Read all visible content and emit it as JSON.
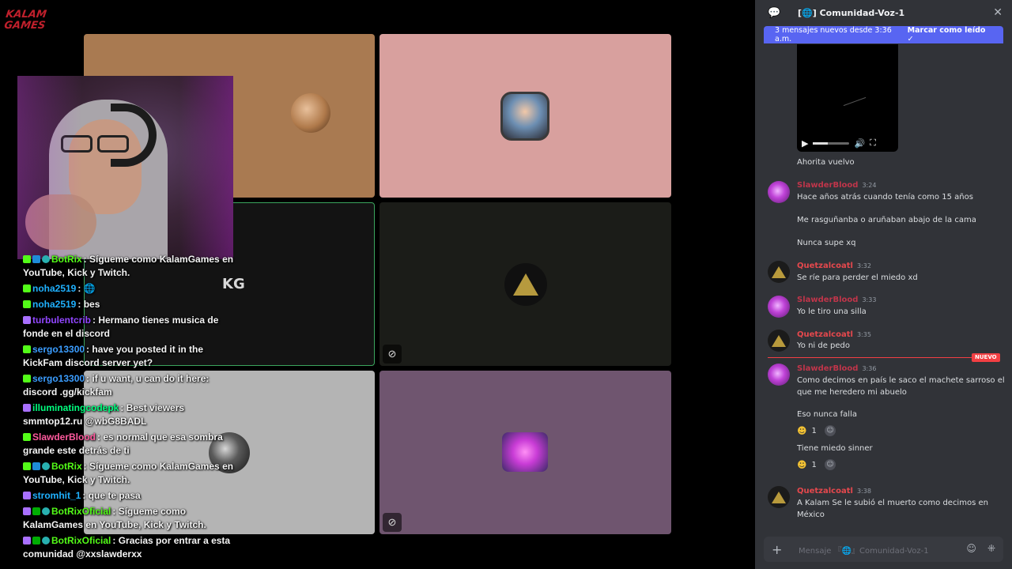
{
  "stream": {
    "logo": {
      "line1": "KALAM",
      "line2": "GAMES"
    },
    "overlay_logo": "KG",
    "colors": {
      "tile_brown": "#a97a51",
      "tile_pink": "#d8a09e",
      "tile_dark": "#131313",
      "tile_gray": "#b4b4b4",
      "tile_purple": "#6f556f",
      "speaking_border": "#3ba55d"
    }
  },
  "chat": [
    {
      "badges": [
        "kick",
        "vip",
        "ok"
      ],
      "user": "BotRix",
      "color": "#53fc18",
      "text": ": Sígueme como KalamGames en YouTube, Kick y Twitch."
    },
    {
      "badges": [
        "kick"
      ],
      "user": "noha2519",
      "color": "#1fb1ff",
      "text": ": 🌐"
    },
    {
      "badges": [
        "kick"
      ],
      "user": "noha2519",
      "color": "#1fb1ff",
      "text": ": bes"
    },
    {
      "badges": [
        "twitch"
      ],
      "user": "turbulentcrib",
      "color": "#9146ff",
      "text": ": Hermano tienes musica de fonde en el discord"
    },
    {
      "badges": [
        "kick"
      ],
      "user": "sergo13300",
      "color": "#3b9dff",
      "text": ": have you posted it in the KickFam discord server yet?"
    },
    {
      "badges": [
        "kick"
      ],
      "user": "sergo13300",
      "color": "#3b9dff",
      "text": ": if u want, u can do it here: discord .gg/kickfam"
    },
    {
      "badges": [
        "twitch"
      ],
      "user": "illuminatingcodepk",
      "color": "#00ff7f",
      "text": ": Best viewers smmtop12.ru @wbG8BADL"
    },
    {
      "badges": [
        "kick"
      ],
      "user": "SlawderBlood",
      "color": "#ff5a9e",
      "text": ": es normal que esa sombra grande este detrás de ti"
    },
    {
      "badges": [
        "kick",
        "vip",
        "ok"
      ],
      "user": "BotRix",
      "color": "#53fc18",
      "text": ": Sígueme como KalamGames en YouTube, Kick y Twitch."
    },
    {
      "badges": [
        "twitch"
      ],
      "user": "stromhit_1",
      "color": "#1fb1ff",
      "text": ": que te pasa"
    },
    {
      "badges": [
        "twitch",
        "mod",
        "ok"
      ],
      "user": "BotRixOficial",
      "color": "#53fc18",
      "text": ": Sígueme como KalamGames en YouTube, Kick y Twitch."
    },
    {
      "badges": [
        "twitch",
        "mod",
        "ok"
      ],
      "user": "BotRixOficial",
      "color": "#53fc18",
      "text": ": Gracias por entrar a esta comunidad @xxslawderxx"
    }
  ],
  "discord": {
    "channel_title": "Comunidad-Voz-1",
    "channel_prefix": "[🌐]",
    "banner_text": "3 mensajes nuevos desde 3:36 a.m.",
    "banner_action": "Marcar como leído",
    "new_badge": "NUEVO",
    "composer_placeholder": "Mensaje 『🌐』Comunidad-Voz-1",
    "messages": {
      "m0": {
        "text": "Ahorita vuelvo"
      },
      "m1": {
        "author": "SlawderBlood",
        "time": "3:24",
        "lines": [
          "Hace años atrás cuando tenía como 15 años",
          "Me rasguñanba o aruñaban abajo de la cama",
          "Nunca supe xq"
        ]
      },
      "m2": {
        "author": "Quetzalcoatl",
        "time": "3:32",
        "text": "Se ríe para perder el miedo xd"
      },
      "m3": {
        "author": "SlawderBlood",
        "time": "3:33",
        "text": "Yo le tiro una silla"
      },
      "m4": {
        "author": "Quetzalcoatl",
        "time": "3:35",
        "text": "Yo ni de pedo"
      },
      "m5": {
        "author": "SlawderBlood",
        "time": "3:36",
        "lines": [
          "Como decimos en país le saco el machete sarroso el",
          "que me heredero mi abuelo",
          "Eso nunca falla",
          "Tiene miedo sinner"
        ],
        "reaction_count": "1",
        "reaction_count2": "1"
      },
      "m6": {
        "author": "Quetzalcoatl",
        "time": "3:38",
        "lines": [
          "A Kalam Se le subió el muerto como decimos en",
          "México"
        ]
      }
    },
    "author_colors": {
      "SlawderBlood": "#c0354a",
      "Quetzalcoatl": "#e5484d"
    }
  }
}
